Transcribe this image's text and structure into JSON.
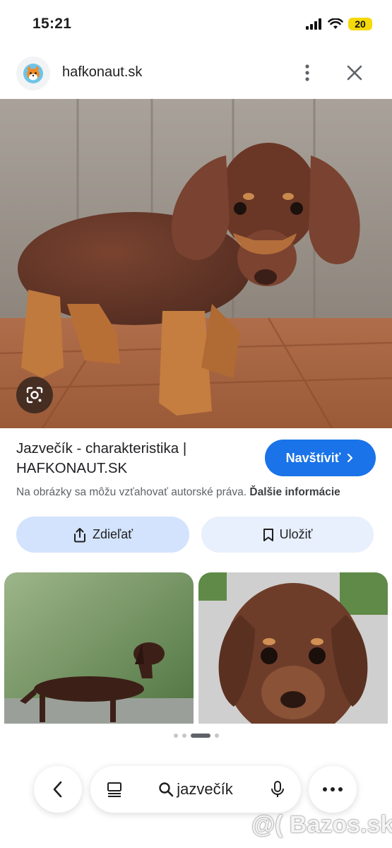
{
  "status_bar": {
    "time": "15:21",
    "battery": "20"
  },
  "header": {
    "domain": "hafkonaut.sk",
    "favicon": "fox-logo-icon"
  },
  "image": {
    "description_icon": "dachshund-photo"
  },
  "result": {
    "title_line1": "Jazvečík - charakteristika |",
    "title_line2": "HAFKONAUT.SK",
    "visit_label": "Navštíviť",
    "copyright_text": "Na obrázky sa môžu vzťahovať autorské práva.",
    "copyright_link": "Ďalšie informácie"
  },
  "actions": {
    "share_label": "Zdieľať",
    "save_label": "Uložiť"
  },
  "carousel": {
    "dots": 4,
    "active_index": 2
  },
  "bottom_bar": {
    "query": "jazvečík"
  },
  "watermark": "@( Bazos.sk",
  "colors": {
    "accent": "#1a73e8",
    "share_bg": "#d3e3fd",
    "save_bg": "#e8f0fd"
  }
}
